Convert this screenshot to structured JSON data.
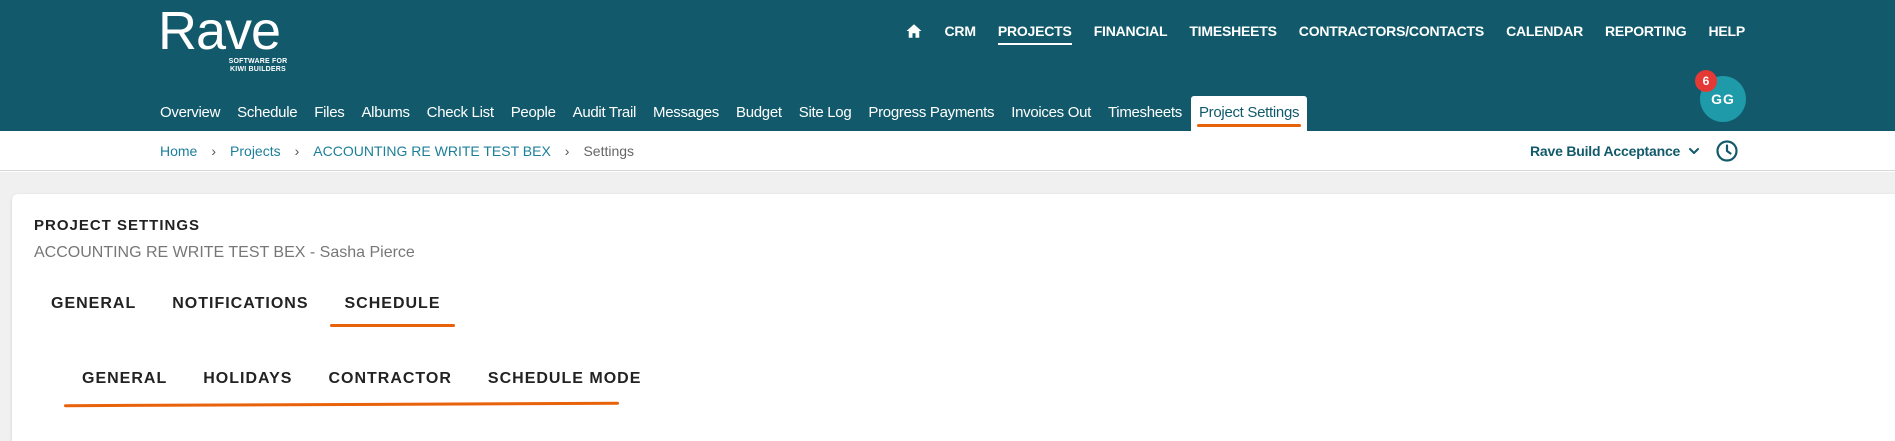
{
  "brand": {
    "name": "Rave",
    "tagline": "SOFTWARE FOR KIWI BUILDERS"
  },
  "main_nav": {
    "home_icon": "home-icon",
    "items": [
      {
        "label": "CRM",
        "active": false
      },
      {
        "label": "PROJECTS",
        "active": true
      },
      {
        "label": "FINANCIAL",
        "active": false
      },
      {
        "label": "TIMESHEETS",
        "active": false
      },
      {
        "label": "CONTRACTORS/CONTACTS",
        "active": false
      },
      {
        "label": "CALENDAR",
        "active": false
      },
      {
        "label": "REPORTING",
        "active": false
      },
      {
        "label": "HELP",
        "active": false
      }
    ]
  },
  "project_nav": {
    "items": [
      {
        "label": "Overview"
      },
      {
        "label": "Schedule"
      },
      {
        "label": "Files"
      },
      {
        "label": "Albums"
      },
      {
        "label": "Check List"
      },
      {
        "label": "People"
      },
      {
        "label": "Audit Trail"
      },
      {
        "label": "Messages"
      },
      {
        "label": "Budget"
      },
      {
        "label": "Site Log"
      },
      {
        "label": "Progress Payments"
      },
      {
        "label": "Invoices Out"
      },
      {
        "label": "Timesheets"
      },
      {
        "label": "Project Settings"
      }
    ],
    "active": "Project Settings"
  },
  "user": {
    "initials": "GG",
    "notification_count": "6"
  },
  "breadcrumb": {
    "home": "Home",
    "projects": "Projects",
    "project": "ACCOUNTING RE WRITE TEST BEX",
    "current": "Settings",
    "separator": "›"
  },
  "company_selector": {
    "label": "Rave Build Acceptance",
    "icon": "chevron-down-icon"
  },
  "history_icon": "clock-icon",
  "page": {
    "title": "PROJECT SETTINGS",
    "subtitle": "ACCOUNTING RE WRITE TEST BEX - Sasha Pierce"
  },
  "settings_tabs": {
    "items": [
      {
        "label": "GENERAL"
      },
      {
        "label": "NOTIFICATIONS"
      },
      {
        "label": "SCHEDULE"
      }
    ],
    "active": "SCHEDULE"
  },
  "schedule_tabs": {
    "items": [
      {
        "label": "GENERAL"
      },
      {
        "label": "HOLIDAYS"
      },
      {
        "label": "CONTRACTOR"
      },
      {
        "label": "SCHEDULE MODE"
      }
    ]
  },
  "colors": {
    "header_bg": "#125a6b",
    "accent": "#e8620a",
    "link": "#1c7f99",
    "avatar": "#1f9aa8",
    "badge": "#e53935"
  }
}
